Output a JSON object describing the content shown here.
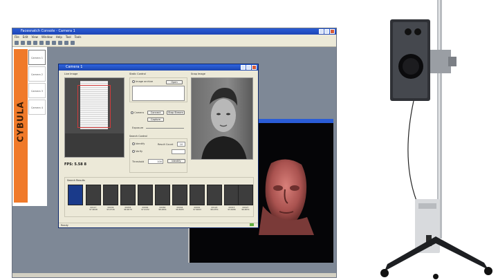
{
  "console": {
    "title": "Facesnatch Console - Camera 1",
    "menu": [
      "File",
      "Edit",
      "View",
      "Window",
      "Help",
      "Tool",
      "Tools"
    ],
    "brand": "CYBULA",
    "camera_tabs": [
      "Camera 1",
      "Camera 2",
      "Camera 3",
      "Camera 4"
    ]
  },
  "camera_dialog": {
    "title": "Camera 1",
    "live_image_label": "Live Image",
    "static_control_label": "Static Control",
    "image_archive_label": "Image archive",
    "open_label": "Open",
    "camera_label": "Camera",
    "connect_label": "Connect",
    "stop_stream_label": "Stop Stream",
    "capture_label": "Capture",
    "exposure_label": "Exposure",
    "snap_image_label": "Snap Image",
    "search_control_label": "Search Control",
    "identify_label": "Identify",
    "verify_label": "Verify",
    "result_count_label": "Result Count",
    "result_count_value": "10",
    "threshold_label": "Threshold",
    "threshold_value": "100",
    "identify_button": "Identify",
    "fps": "FPS: 5.58",
    "fps_value": "8",
    "search_results_label": "Search Results",
    "status": "Ready",
    "results": [
      {
        "id": "",
        "score": ""
      },
      {
        "id": "00117",
        "score": "97.6048"
      },
      {
        "id": "00036",
        "score": "93.0726"
      },
      {
        "id": "00055",
        "score": "96.9079"
      },
      {
        "id": "00064",
        "score": "97.4132"
      },
      {
        "id": "00082",
        "score": "98.4891"
      },
      {
        "id": "00044",
        "score": "96.8465"
      },
      {
        "id": "00091",
        "score": "97.6064"
      },
      {
        "id": "00122",
        "score": "98.4351"
      },
      {
        "id": "00015",
        "score": "93.6486"
      },
      {
        "id": "00027",
        "score": "96.6051"
      }
    ]
  }
}
